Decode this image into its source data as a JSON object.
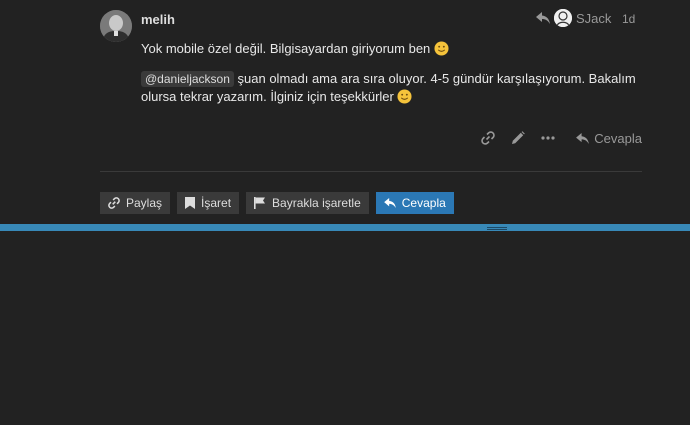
{
  "post": {
    "username": "melih",
    "reply_to_user": "SJack",
    "date": "1d",
    "paragraph1": "Yok mobile özel değil. Bilgisayardan giriyorum ben",
    "mention": "@danieljackson",
    "paragraph2": " şuan olmadı ama ara sıra oluyor. 4-5 gündür karşılaşıyorum. Bakalım olursa tekrar yazarım. İlginiz için teşekkürler",
    "reply_label": "Cevapla"
  },
  "topic_buttons": {
    "share": "Paylaş",
    "bookmark": "İşaret",
    "flag": "Bayrakla işaretle",
    "reply": "Cevapla"
  },
  "colors": {
    "background": "#222222",
    "accent": "#2b78b5",
    "bar": "#3889b8"
  },
  "icons": [
    "link-icon",
    "pencil-icon",
    "ellipsis-icon",
    "reply-icon",
    "bookmark-icon",
    "flag-icon",
    "smile-emoji-icon"
  ]
}
